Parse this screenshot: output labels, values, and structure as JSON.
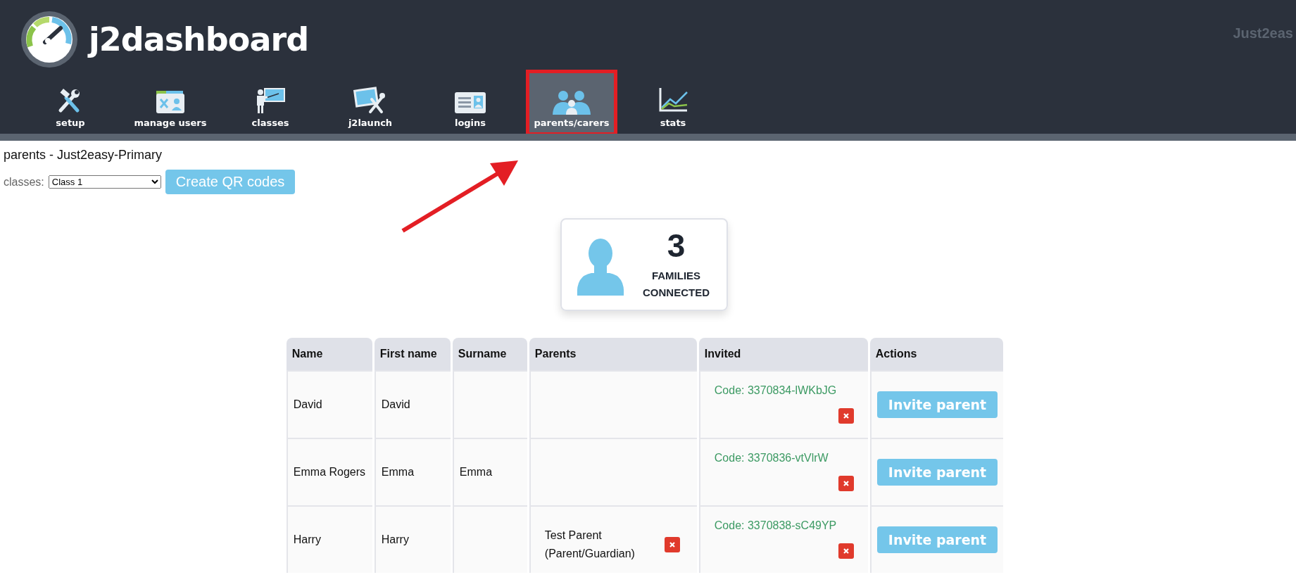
{
  "header": {
    "logo_text": "j2dashboard",
    "account": "Just2eas"
  },
  "nav": [
    {
      "label": "setup",
      "selected": false,
      "highlighted": false
    },
    {
      "label": "manage users",
      "selected": false,
      "highlighted": false
    },
    {
      "label": "classes",
      "selected": false,
      "highlighted": false
    },
    {
      "label": "j2launch",
      "selected": false,
      "highlighted": false
    },
    {
      "label": "logins",
      "selected": false,
      "highlighted": false
    },
    {
      "label": "parents/carers",
      "selected": true,
      "highlighted": true
    },
    {
      "label": "stats",
      "selected": false,
      "highlighted": false
    }
  ],
  "page_title": "parents - Just2easy-Primary",
  "class_filter": {
    "label": "classes:",
    "value": "Class 1"
  },
  "qr_button": "Create QR codes",
  "summary": {
    "count": "3",
    "caption": "FAMILIES CONNECTED"
  },
  "table": {
    "columns": [
      "Name",
      "First name",
      "Surname",
      "Parents",
      "Invited",
      "Actions"
    ],
    "rows": [
      {
        "name": "David",
        "first_name": "David",
        "surname": "",
        "parents": [],
        "invited": "Code: 3370834-lWKbJG",
        "action": "Invite parent"
      },
      {
        "name": "Emma Rogers",
        "first_name": "Emma",
        "surname": "Emma",
        "parents": [],
        "invited": "Code: 3370836-vtVlrW",
        "action": "Invite parent"
      },
      {
        "name": "Harry",
        "first_name": "Harry",
        "surname": "",
        "parents": [
          "Test Parent (Parent/Guardian)"
        ],
        "invited": "Code: 3370838-sC49YP",
        "action": "Invite parent"
      }
    ]
  }
}
